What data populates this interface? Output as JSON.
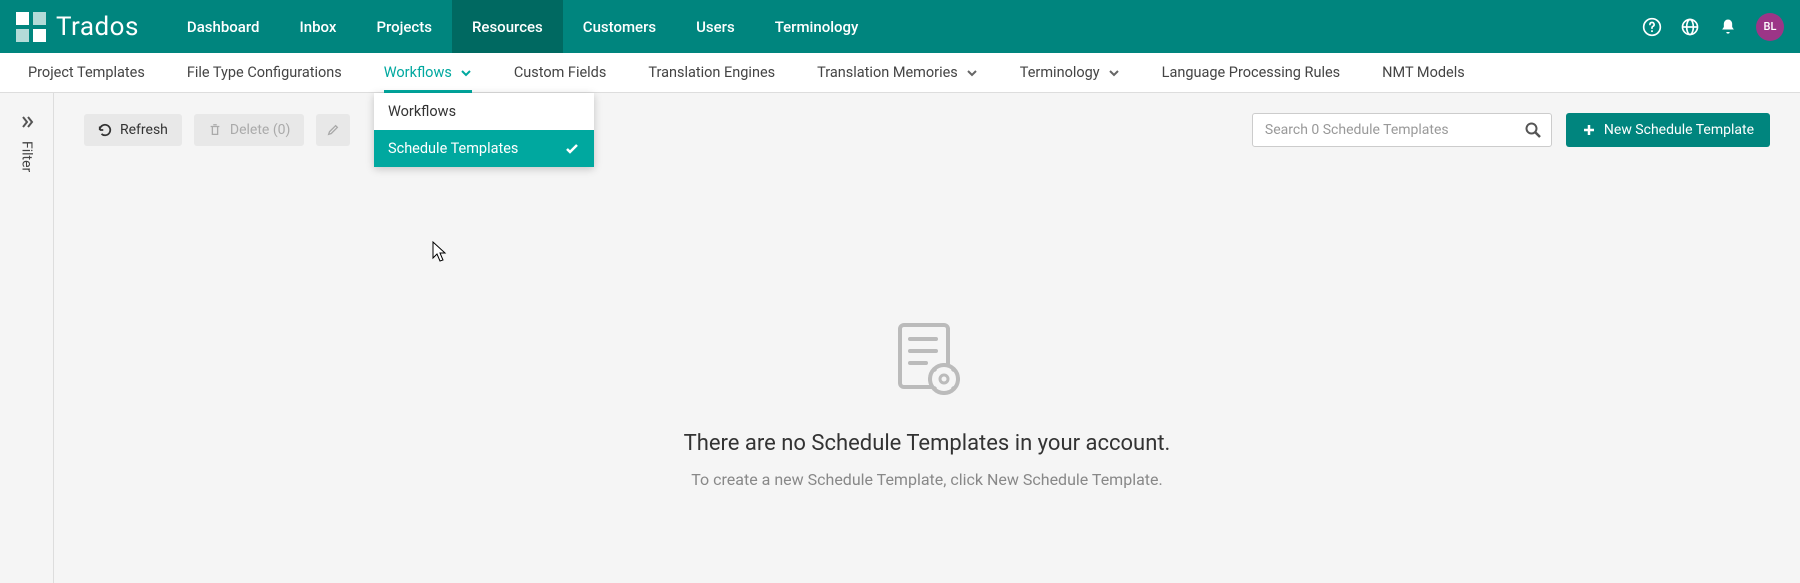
{
  "brand": "Trados",
  "avatar_initials": "BL",
  "nav": {
    "items": [
      {
        "label": "Dashboard"
      },
      {
        "label": "Inbox"
      },
      {
        "label": "Projects"
      },
      {
        "label": "Resources"
      },
      {
        "label": "Customers"
      },
      {
        "label": "Users"
      },
      {
        "label": "Terminology"
      }
    ]
  },
  "subnav": {
    "items": [
      {
        "label": "Project Templates"
      },
      {
        "label": "File Type Configurations"
      },
      {
        "label": "Workflows"
      },
      {
        "label": "Custom Fields"
      },
      {
        "label": "Translation Engines"
      },
      {
        "label": "Translation Memories"
      },
      {
        "label": "Terminology"
      },
      {
        "label": "Language Processing Rules"
      },
      {
        "label": "NMT Models"
      }
    ]
  },
  "dropdown": {
    "items": [
      {
        "label": "Workflows"
      },
      {
        "label": "Schedule Templates"
      }
    ]
  },
  "filter": {
    "label": "Filter"
  },
  "toolbar": {
    "refresh_label": "Refresh",
    "delete_label": "Delete (0)",
    "search_placeholder": "Search 0 Schedule Templates",
    "new_button_label": "New Schedule Template"
  },
  "empty": {
    "title": "There are no Schedule Templates in your account.",
    "subtitle": "To create a new Schedule Template, click New Schedule Template."
  }
}
